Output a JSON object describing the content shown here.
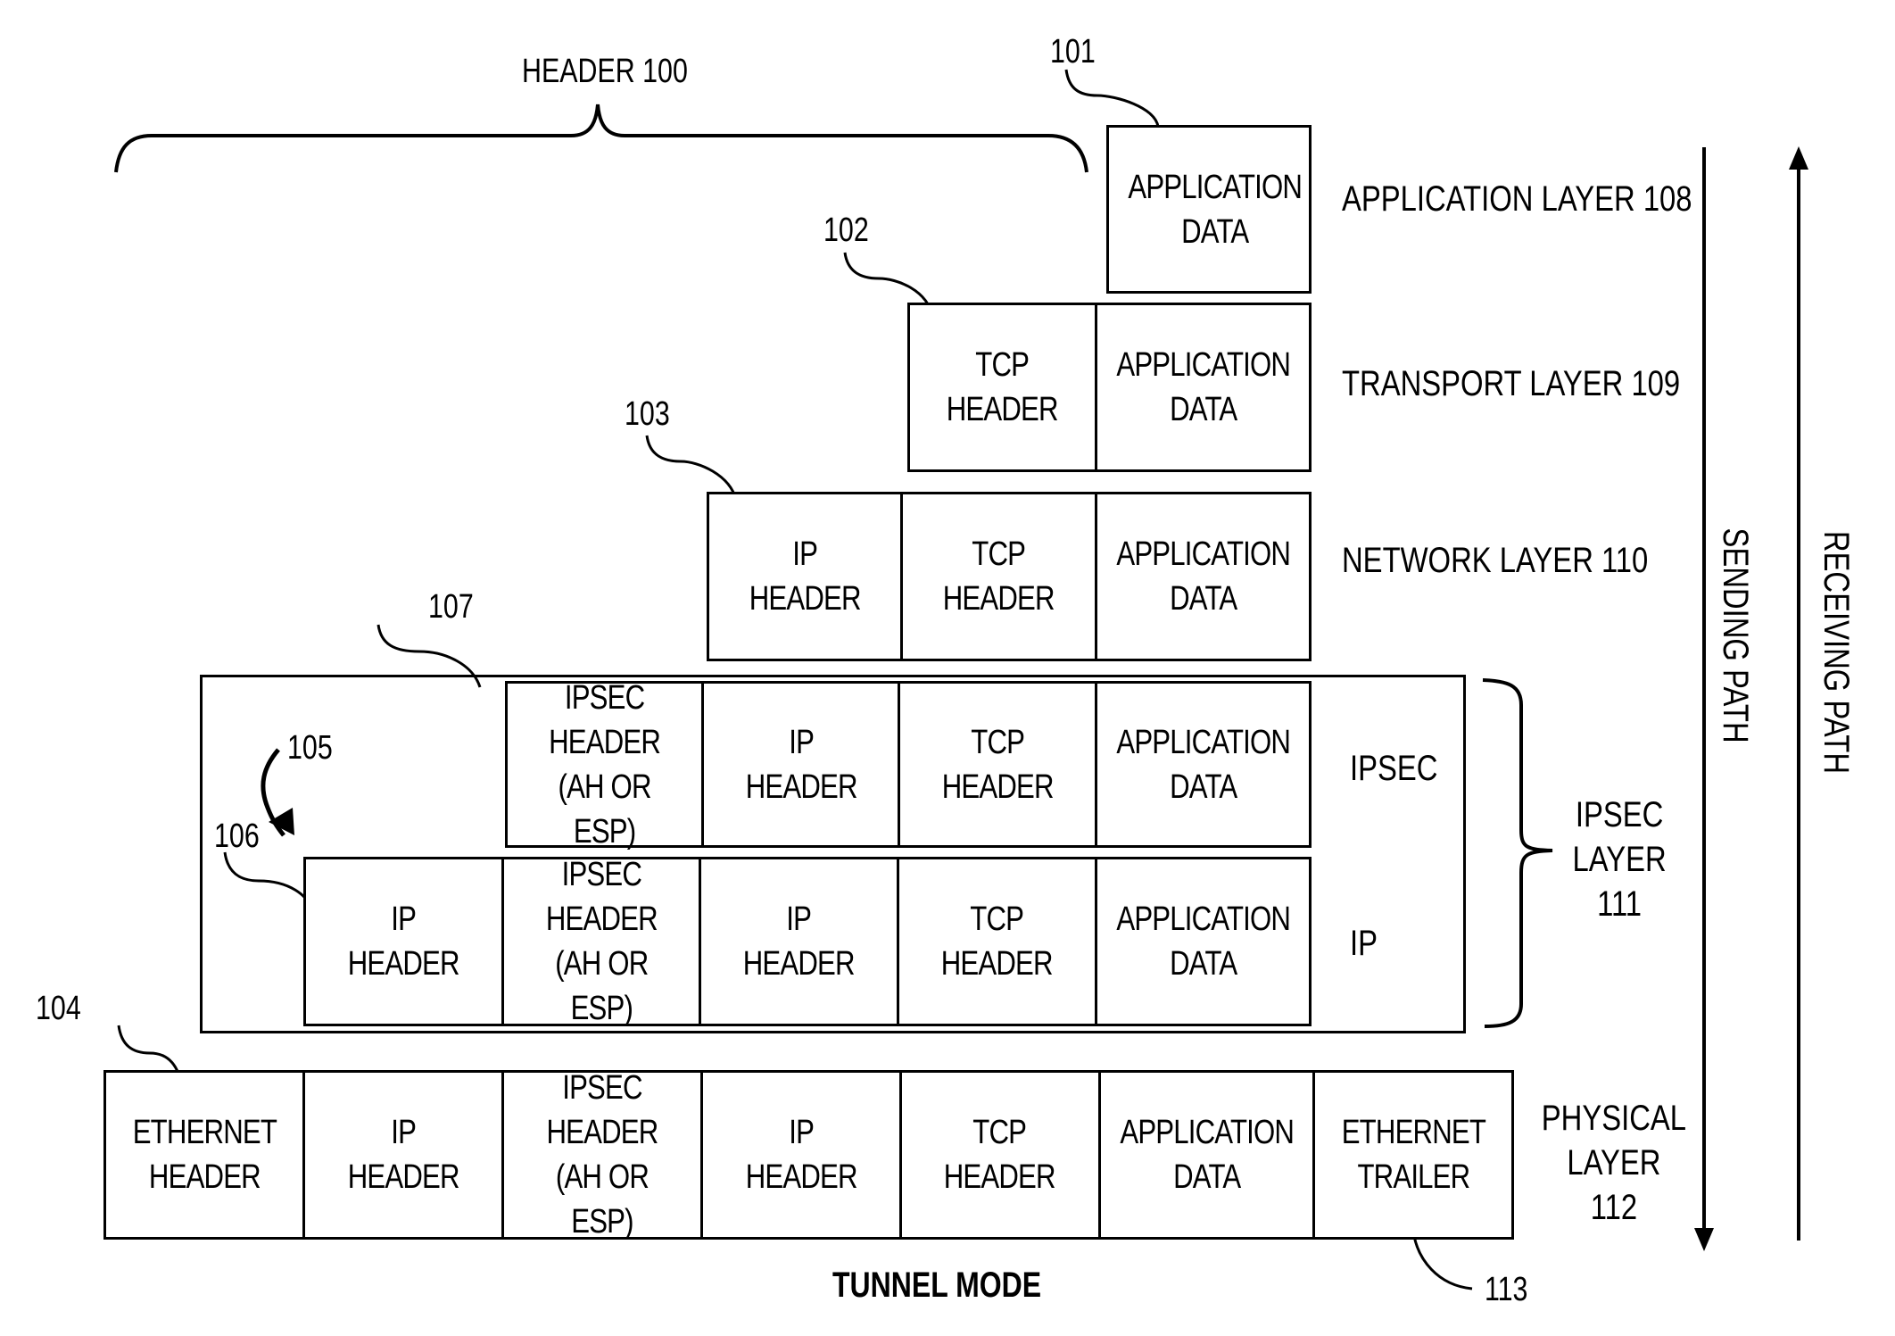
{
  "diagram": {
    "title": "TUNNEL MODE",
    "header_brace_label": "HEADER 100",
    "reference_numerals": {
      "r101": "101",
      "r102": "102",
      "r103": "103",
      "r104": "104",
      "r105": "105",
      "r106": "106",
      "r107": "107",
      "r113": "113"
    },
    "layers": {
      "application": {
        "label": "APPLICATION LAYER 108",
        "cells": [
          "APPLICATION\nDATA"
        ]
      },
      "transport": {
        "label": "TRANSPORT LAYER 109",
        "cells": [
          "TCP\nHEADER",
          "APPLICATION\nDATA"
        ]
      },
      "network": {
        "label": "NETWORK LAYER 110",
        "cells": [
          "IP\nHEADER",
          "TCP\nHEADER",
          "APPLICATION\nDATA"
        ]
      },
      "ipsec": {
        "label": "IPSEC\nLAYER\n111",
        "sub_ipsec_label": "IPSEC",
        "sub_ip_label": "IP",
        "ipsec_row_cells": [
          "IPSEC\nHEADER\n(AH OR ESP)",
          "IP\nHEADER",
          "TCP\nHEADER",
          "APPLICATION\nDATA"
        ],
        "ip_row_cells": [
          "IP\nHEADER",
          "IPSEC\nHEADER\n(AH OR ESP)",
          "IP\nHEADER",
          "TCP\nHEADER",
          "APPLICATION\nDATA"
        ]
      },
      "physical": {
        "label": "PHYSICAL\nLAYER\n112",
        "cells": [
          "ETHERNET\nHEADER",
          "IP\nHEADER",
          "IPSEC\nHEADER\n(AH OR ESP)",
          "IP\nHEADER",
          "TCP\nHEADER",
          "APPLICATION\nDATA",
          "ETHERNET\nTRAILER"
        ]
      }
    },
    "paths": {
      "sending": "SENDING PATH",
      "receiving": "RECEIVING PATH"
    }
  }
}
